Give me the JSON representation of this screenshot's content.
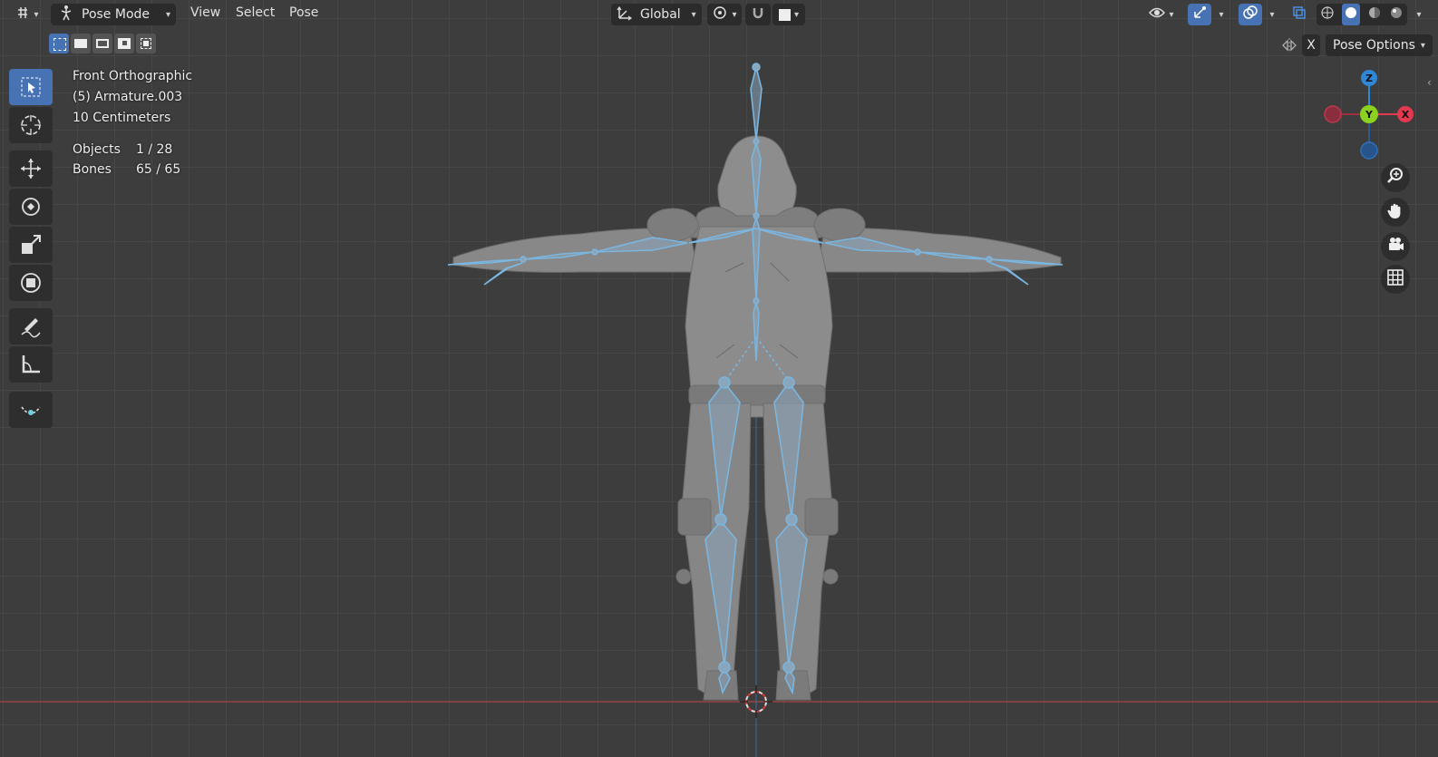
{
  "header": {
    "mode_label": "Pose Mode",
    "menus": [
      "View",
      "Select",
      "Pose"
    ],
    "transform_orientation": "Global",
    "pose_options_label": "Pose Options",
    "x_mirror_label": "X"
  },
  "overlay": {
    "view_name": "Front Orthographic",
    "active_object": "(5) Armature.003",
    "grid_scale": "10 Centimeters",
    "stats": [
      {
        "label": "Objects",
        "value": "1 / 28"
      },
      {
        "label": "Bones",
        "value": "65 / 65"
      }
    ]
  },
  "gizmo": {
    "z": "Z",
    "y": "Y",
    "x": "X"
  },
  "colors": {
    "accent": "#4772b3",
    "bone": "#7ab6e0",
    "axis_x": "#e2394f",
    "axis_y": "#8bd11f",
    "axis_z": "#2f87d8"
  },
  "icons": {
    "editor_type": "grid-editor-icon",
    "tools": [
      "select-box-icon",
      "cursor-icon",
      "move-icon",
      "rotate-icon",
      "scale-icon",
      "transform-icon",
      "annotate-icon",
      "measure-icon",
      "relax-icon"
    ]
  }
}
